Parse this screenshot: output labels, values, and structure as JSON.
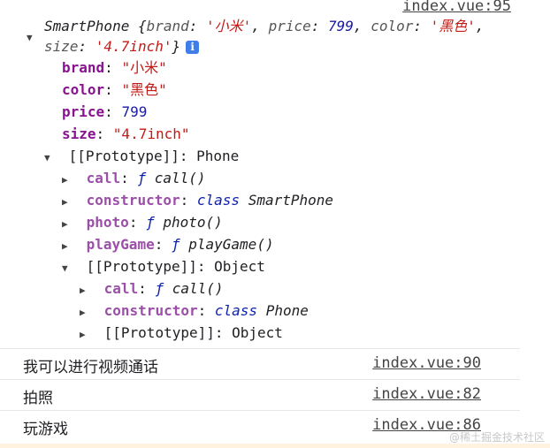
{
  "header": {
    "link": "index.vue:95",
    "class_name": "SmartPhone",
    "summary": {
      "open": " {",
      "brand_key": "brand",
      "brand_val": "'小米'",
      "price_key": "price",
      "price_val": "799",
      "color_key": "color",
      "color_val": "'黑色'",
      "size_key": "size",
      "size_val": "'4.7inch'",
      "close": "}",
      "sep": ": ",
      "comma": ", "
    },
    "info_glyph": "i"
  },
  "props": [
    {
      "key": "brand",
      "value": "\"小米\"",
      "type": "string"
    },
    {
      "key": "color",
      "value": "\"黑色\"",
      "type": "string"
    },
    {
      "key": "price",
      "value": "799",
      "type": "number"
    },
    {
      "key": "size",
      "value": "\"4.7inch\"",
      "type": "string"
    }
  ],
  "proto1": {
    "label": "[[Prototype]]",
    "value": "Phone"
  },
  "proto1_items": [
    {
      "key": "call",
      "f": "ƒ",
      "value": "call()"
    },
    {
      "key": "constructor",
      "f": "class",
      "value": "SmartPhone"
    },
    {
      "key": "photo",
      "f": "ƒ",
      "value": "photo()"
    },
    {
      "key": "playGame",
      "f": "ƒ",
      "value": "playGame()"
    }
  ],
  "proto2": {
    "label": "[[Prototype]]",
    "value": "Object"
  },
  "proto2_items": [
    {
      "key": "call",
      "f": "ƒ",
      "value": "call()"
    },
    {
      "key": "constructor",
      "f": "class",
      "value": "Phone"
    }
  ],
  "proto3": {
    "label": "[[Prototype]]",
    "value": "Object"
  },
  "logs": [
    {
      "text": "我可以进行视频通话",
      "link": "index.vue:90"
    },
    {
      "text": "拍照",
      "link": "index.vue:82"
    },
    {
      "text": "玩游戏",
      "link": "index.vue:86"
    }
  ],
  "watermark": "@稀土掘金技术社区",
  "icons": {
    "collapsed": "▶",
    "expanded": "▼"
  }
}
